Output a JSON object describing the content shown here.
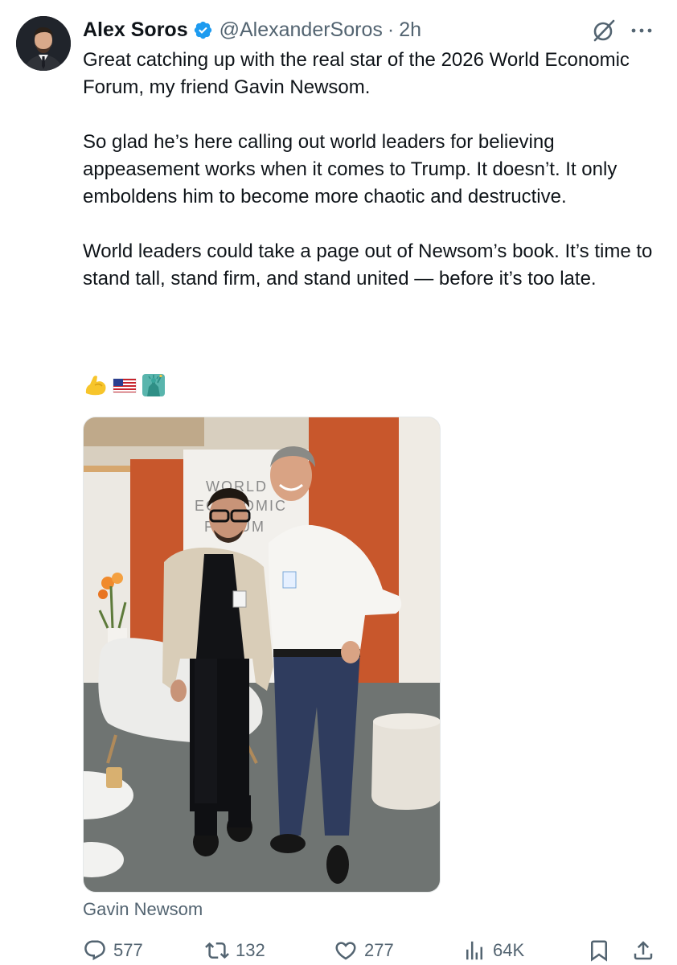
{
  "tweet": {
    "author_name": "Alex Soros",
    "handle": "@AlexanderSoros",
    "separator": "·",
    "time": "2h",
    "paragraphs": [
      "Great catching up with the real star of the 2026 World Economic Forum, my friend Gavin Newsom.",
      "So glad he’s here calling out world leaders for believing appeasement works when it comes to Trump. It doesn’t. It only emboldens him to become more chaotic and destructive.",
      "World leaders could take a page out of Newsom’s book. It’s time to stand tall, stand firm, and stand united — before it’s too late."
    ],
    "emojis": [
      "flexed-biceps-emoji",
      "us-flag-emoji",
      "statue-of-liberty-emoji"
    ],
    "photo_sign_text": [
      "WORLD",
      "ECONOMIC",
      "FORUM"
    ],
    "media_caption": "Gavin Newsom"
  },
  "actions": {
    "replies": "577",
    "reposts": "132",
    "likes": "277",
    "views": "64K"
  },
  "colors": {
    "text": "#0f1419",
    "secondary": "#536471",
    "verified": "#1d9bf0",
    "wall_orange": "#c8572c"
  },
  "icons": [
    "verified-badge-icon",
    "grok-icon",
    "more-icon",
    "reply-icon",
    "repost-icon",
    "like-icon",
    "views-icon",
    "bookmark-icon",
    "share-icon"
  ]
}
